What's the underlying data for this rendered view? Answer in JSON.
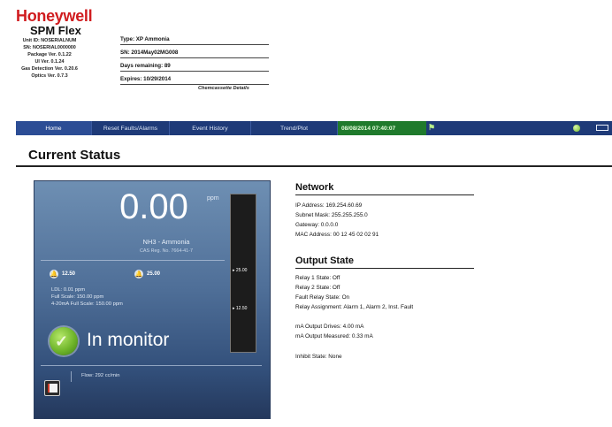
{
  "header": {
    "brand": "Honeywell",
    "product": "SPM Flex",
    "device_info": [
      "Unit ID: NOSERIALNUM",
      "SN: NOSERIAL0000000",
      "Package Ver. 0.1.22",
      "UI Ver. 0.1.24",
      "Gas Detection Ver. 0.20.6",
      "Optics Ver. 0.7.3"
    ]
  },
  "cassette": {
    "type": "Type: XP Ammonia",
    "sn": "SN: 2014May02MG008",
    "days": "Days remaining: 89",
    "expires": "Expires: 10/29/2014",
    "details_link": "Chemcassette Details"
  },
  "nav": {
    "items": [
      "Home",
      "Reset Faults/Alarms",
      "Event History",
      "Trend/Plot"
    ],
    "datetime": "08/08/2014 07:40:07",
    "flag_icon": "flag-icon",
    "status_icon": "status-dot-icon",
    "battery_icon": "battery-icon",
    "colors": {
      "bar": "#1e3a78",
      "clock": "#1f7a2c"
    }
  },
  "page": {
    "title": "Current Status"
  },
  "reading": {
    "value": "0.00",
    "unit": "ppm",
    "gas": "NH3 - Ammonia",
    "cas": "CAS Reg. No. 7664-41-7",
    "alarm1": "12.50",
    "alarm2": "25.00",
    "ldl": "LDL: 0.01 ppm",
    "full_scale": "Full Scale: 150.00 ppm",
    "full_scale_4_20": "4-20mA Full Scale: 150.00 ppm",
    "bar_tick_high": "25.00",
    "bar_tick_low": "12.50",
    "status": "In monitor",
    "flow": "Flow: 292 cc/min",
    "status_color": "#6fb52a"
  },
  "network": {
    "heading": "Network",
    "ip": "IP Address: 169.254.60.69",
    "subnet": "Subnet Mask: 255.255.255.0",
    "gateway": "Gateway: 0.0.0.0",
    "mac": "MAC Address: 00 12 45 02 02 91"
  },
  "output": {
    "heading": "Output State",
    "relay1": "Relay 1 State: Off",
    "relay2": "Relay 2 State: Off",
    "fault_relay": "Fault Relay State: On",
    "relay_assignment": "Relay Assignment: Alarm 1, Alarm 2, Inst. Fault",
    "ma_drives": "mA Output Drives: 4.00 mA",
    "ma_measured": "mA Output Measured: 0.33 mA",
    "inhibit": "Inhibit State: None"
  }
}
